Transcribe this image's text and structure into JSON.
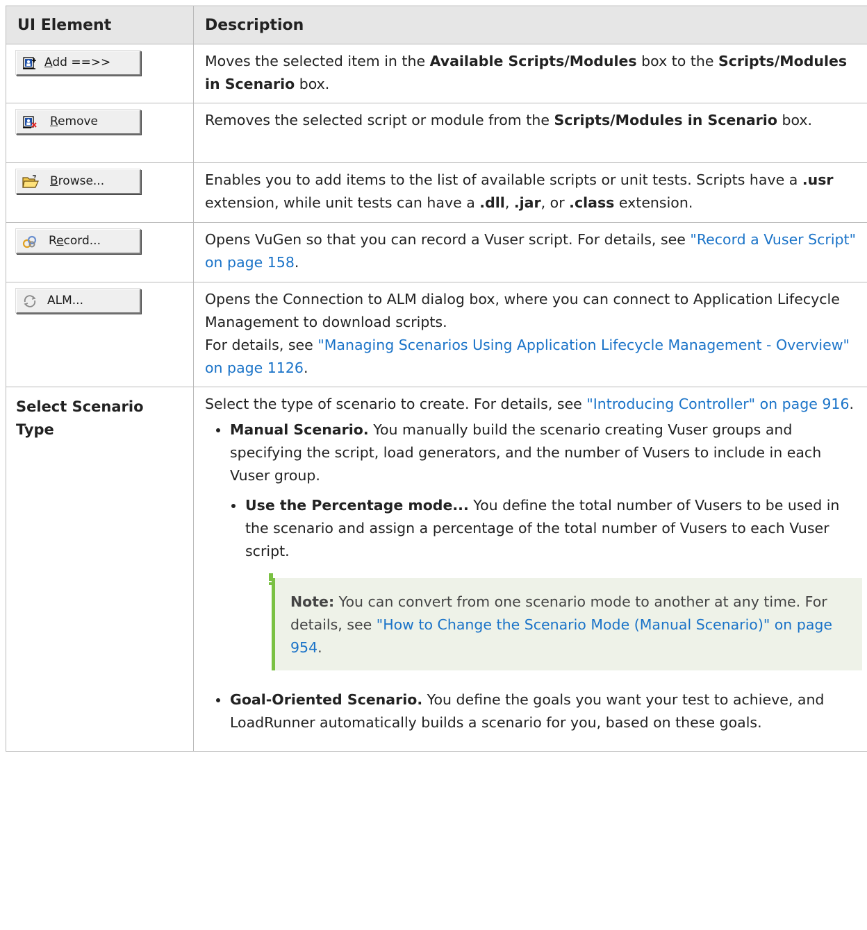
{
  "table": {
    "headers": [
      "UI Element",
      "Description"
    ]
  },
  "rows": {
    "add": {
      "button_label": "Add ==>>",
      "button_mnemonic": "A",
      "icon": "add-script-icon",
      "desc": {
        "t1": "Moves the selected item in the ",
        "b1": "Available Scripts/Modules",
        "t2": " box to the ",
        "b2": "Scripts/Modules in Scenario",
        "t3": " box."
      }
    },
    "remove": {
      "button_label": "Remove",
      "button_mnemonic": "R",
      "icon": "remove-script-icon",
      "desc": {
        "t1": "Removes the selected script or module from the ",
        "b1": "Scripts/Modules in Scenario",
        "t2": " box."
      }
    },
    "browse": {
      "button_label": "Browse...",
      "button_mnemonic": "B",
      "icon": "folder-open-icon",
      "desc": {
        "t1": "Enables you to add items to the list of available scripts or unit tests. Scripts have a ",
        "b1": ".usr",
        "t2": " extension, while unit tests can have a ",
        "b2": ".dll",
        "t3": ", ",
        "b3": ".jar",
        "t4": ", or ",
        "b4": ".class",
        "t5": " extension."
      }
    },
    "record": {
      "button_label": "Record...",
      "button_mnemonic": "e",
      "icon": "vugen-record-icon",
      "desc": {
        "t1": "Opens VuGen so that you can record a Vuser script. For details, see ",
        "link": "\"Record a Vuser Script\" on page 158",
        "t2": "."
      }
    },
    "alm": {
      "button_label": "ALM...",
      "icon": "alm-connection-icon",
      "desc": {
        "line1": "Opens the Connection to ALM dialog box, where you can connect to Application Lifecycle Management to download scripts.",
        "t1": "For details, see ",
        "link": "\"Managing Scenarios Using Application Lifecycle Management - Overview\" on page 1126",
        "t2": "."
      }
    },
    "scenario_type": {
      "element": "Select Scenario Type",
      "intro": "Select the type of scenario to create. For details, see ",
      "intro_link": "\"Introducing Controller\" on page 916",
      "intro_end": ".",
      "manual_title": "Manual Scenario.",
      "manual_text": " You manually build the scenario creating Vuser groups and specifying the script, load generators, and the number of Vusers to include in each Vuser group.",
      "percentage_title": "Use the Percentage mode...",
      "percentage_text": " You define the total number of Vusers to be used in the scenario and assign a percentage of the total number of Vusers to each Vuser script.",
      "note_label": "Note:",
      "note_text": " You can convert from one scenario mode to another at any time. For details, see ",
      "note_link": "\"How to Change the Scenario Mode (Manual Scenario)\" on page 954",
      "note_end": ".",
      "goal_title": "Goal-Oriented Scenario.",
      "goal_text": " You define the goals you want your test to achieve, and LoadRunner automatically builds a scenario for you, based on these goals."
    }
  },
  "colors": {
    "link": "#1a73c8",
    "header_bg": "#e6e6e6",
    "note_bg": "#eef2e8",
    "note_bar": "#7ac143"
  }
}
